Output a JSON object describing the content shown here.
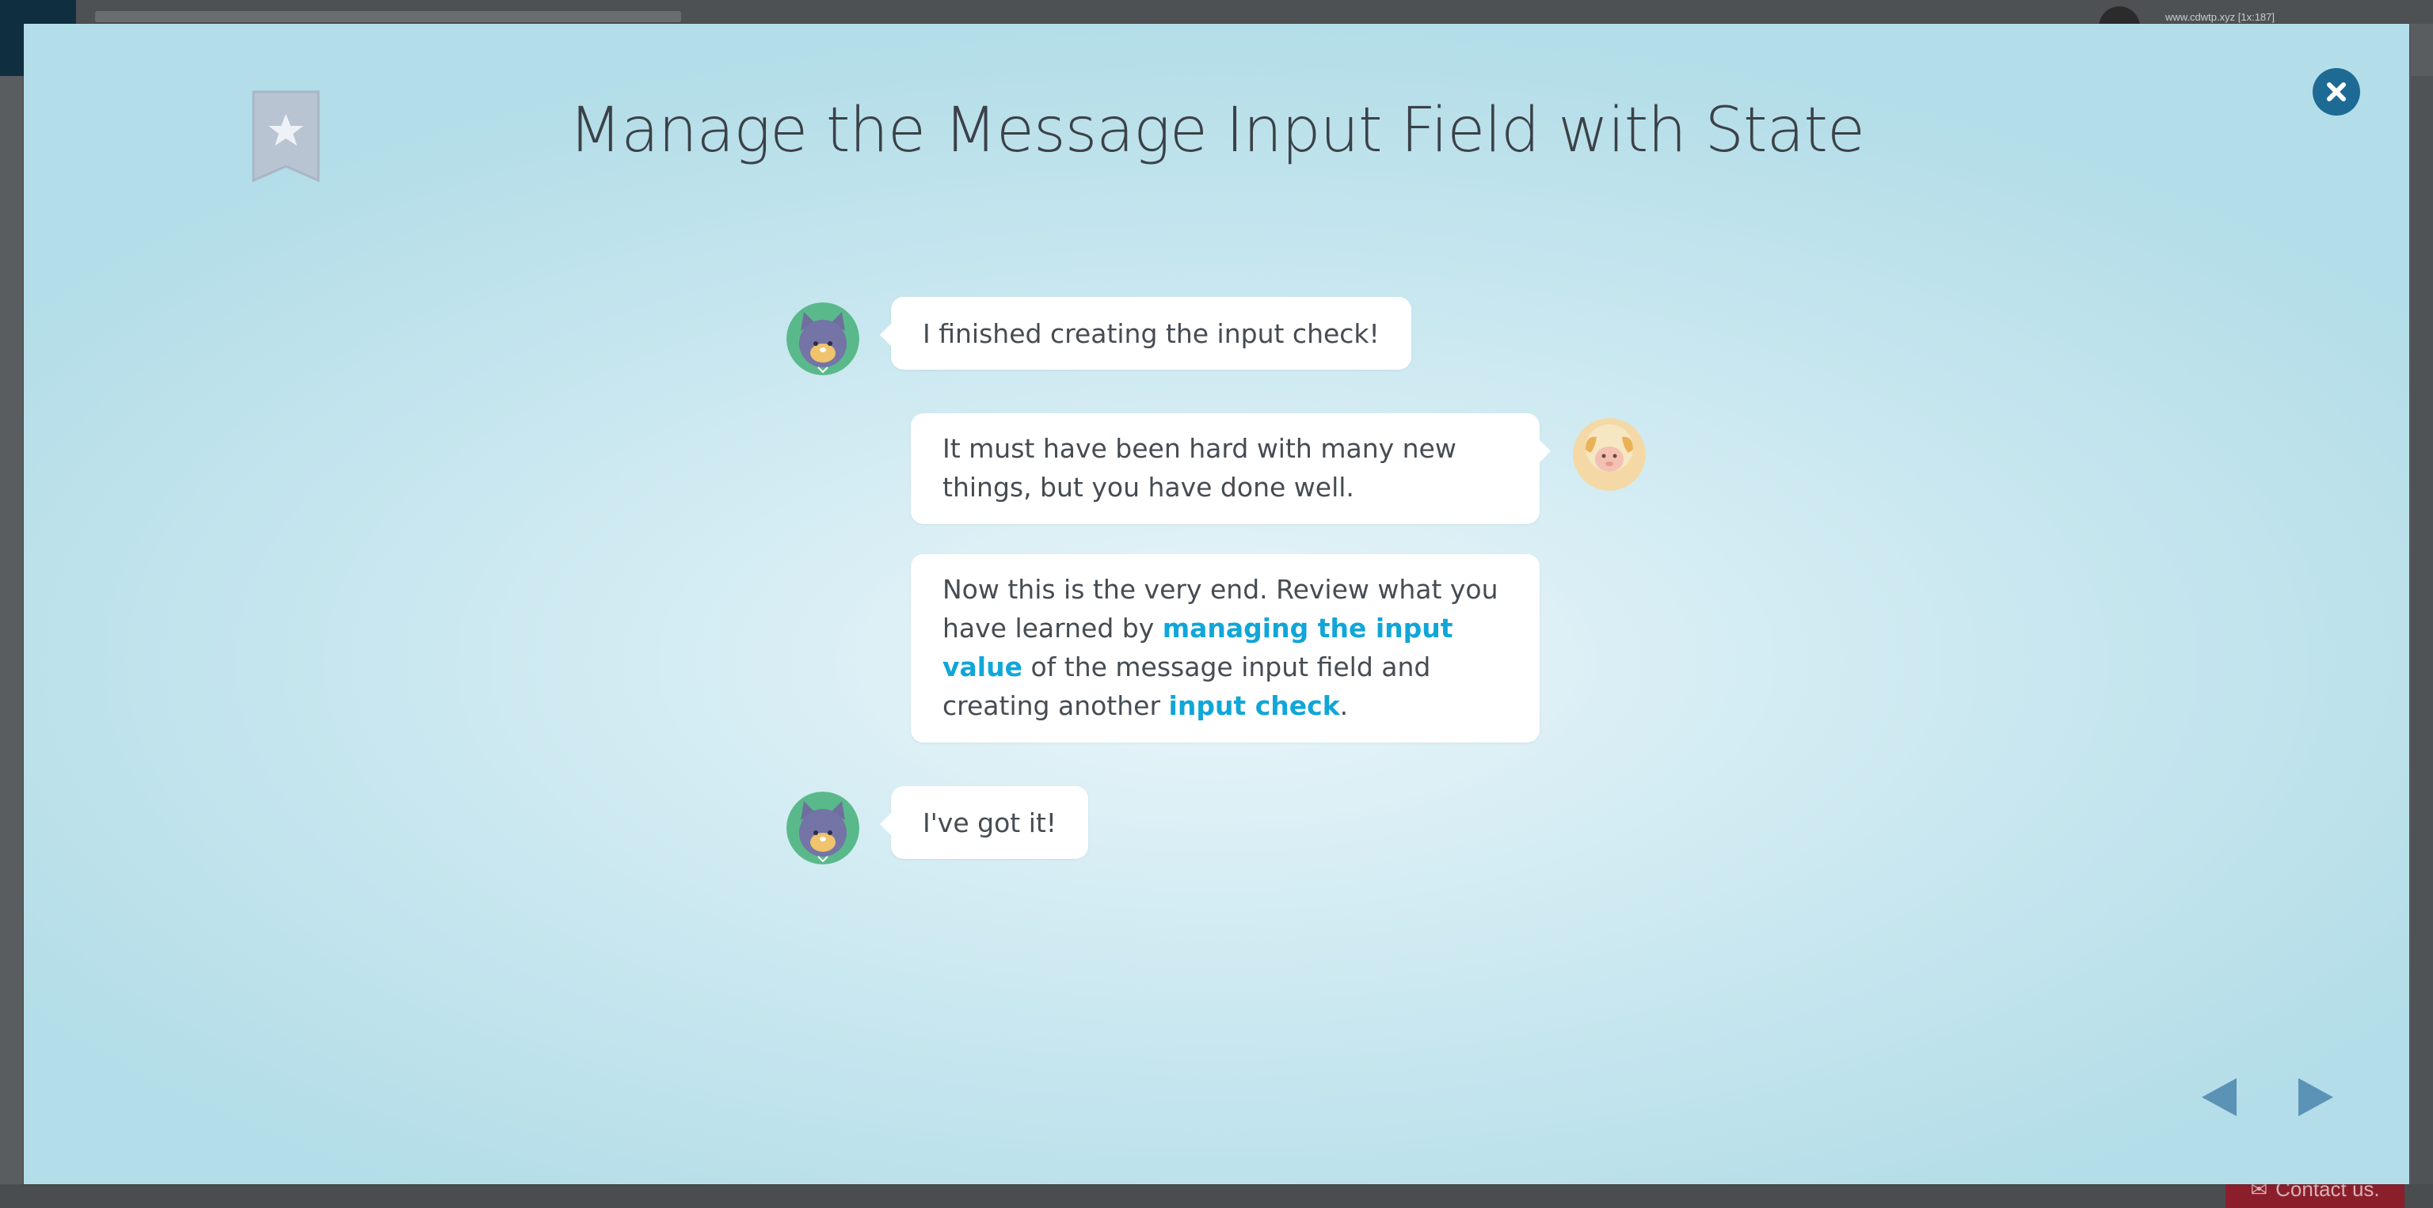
{
  "background": {
    "user_text": "www.cdwtp.xyz [1x:187]",
    "contact_label": "Contact us."
  },
  "modal": {
    "title": "Manage the Message Input Field with State",
    "colors": {
      "close_button": "#1d6b95",
      "highlight": "#10a6d8",
      "nav_arrow": "#5b93b7",
      "bookmark": "#b8c4d2"
    }
  },
  "messages": [
    {
      "speaker": "cat",
      "side": "left",
      "text": "I finished creating the input check!"
    },
    {
      "speaker": "sheep",
      "side": "right",
      "text": "It must have been hard with many new things, but you have done well."
    },
    {
      "speaker": "sheep",
      "side": "right",
      "parts": [
        "Now this is the very end. Review what you have learned by ",
        "managing the input value",
        " of the message input field and creating another ",
        "input check",
        "."
      ]
    },
    {
      "speaker": "cat",
      "side": "left",
      "text": "I've got it!"
    }
  ],
  "icons": {
    "close": "close-icon",
    "bookmark": "bookmark-star-icon",
    "prev": "prev-arrow-icon",
    "next": "next-arrow-icon"
  }
}
